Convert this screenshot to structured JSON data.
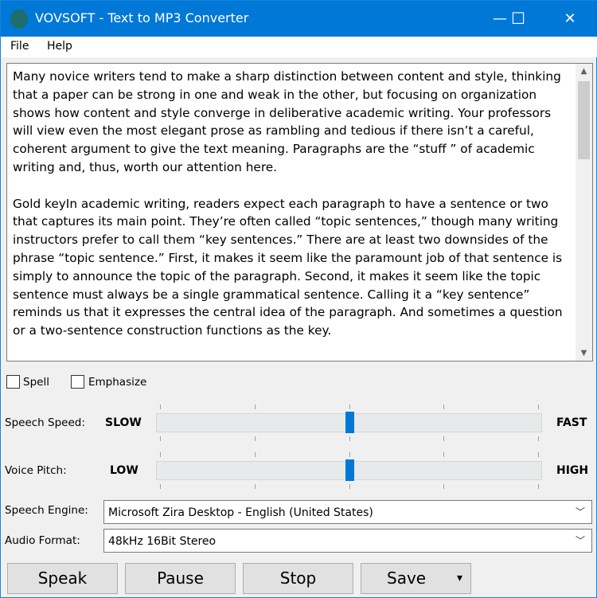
{
  "window": {
    "title": "VOVSOFT - Text to MP3 Converter",
    "minimize": "—",
    "maximize": "☐",
    "close": "✕"
  },
  "menu": [
    "File",
    "Help"
  ],
  "text": "Many novice writers tend to make a sharp distinction between content and style, thinking that a paper can be strong in one and weak in the other, but focusing on organization shows how content and style converge in deliberative academic writing. Your professors will view even the most elegant prose as rambling and tedious if there isn’t a careful, coherent argument to give the text meaning. Paragraphs are the “stuff ” of academic writing and, thus, worth our attention here.\n\nGold keyIn academic writing, readers expect each paragraph to have a sentence or two that captures its main point. They’re often called “topic sentences,” though many writing instructors prefer to call them “key sentences.” There are at least two downsides of the phrase “topic sentence.” First, it makes it seem like the paramount job of that sentence is simply to announce the topic of the paragraph. Second, it makes it seem like the topic sentence must always be a single grammatical sentence. Calling it a “key sentence” reminds us that it expresses the central idea of the paragraph. And sometimes a question or a two-sentence construction functions as the key.",
  "options": {
    "spell": {
      "label": "Spell",
      "checked": false
    },
    "emphasize": {
      "label": "Emphasize",
      "checked": false
    }
  },
  "speed": {
    "label": "Speech Speed:",
    "min_label": "SLOW",
    "max_label": "FAST",
    "value": 0.5
  },
  "pitch": {
    "label": "Voice Pitch:",
    "min_label": "LOW",
    "max_label": "HIGH",
    "value": 0.5
  },
  "engine": {
    "label": "Speech Engine:",
    "value": "Microsoft Zira Desktop - English (United States)"
  },
  "format": {
    "label": "Audio Format:",
    "value": "48kHz 16Bit Stereo"
  },
  "buttons": {
    "speak": "Speak",
    "pause": "Pause",
    "stop": "Stop",
    "save": "Save",
    "save_arrow": "▾"
  },
  "colors": {
    "accent": "#0078d7"
  }
}
